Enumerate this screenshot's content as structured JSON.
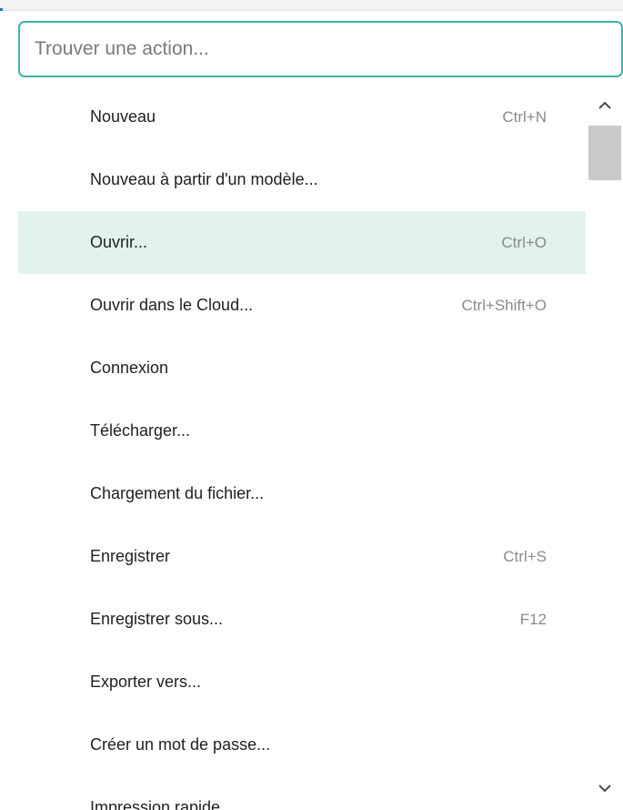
{
  "search": {
    "value": "",
    "placeholder": "Trouver une action..."
  },
  "actions": [
    {
      "label": "Nouveau",
      "shortcut": "Ctrl+N"
    },
    {
      "label": "Nouveau à partir d'un modèle...",
      "shortcut": ""
    },
    {
      "label": "Ouvrir...",
      "shortcut": "Ctrl+O",
      "highlighted": true
    },
    {
      "label": "Ouvrir dans le Cloud...",
      "shortcut": "Ctrl+Shift+O"
    },
    {
      "label": "Connexion",
      "shortcut": ""
    },
    {
      "label": "Télécharger...",
      "shortcut": ""
    },
    {
      "label": "Chargement du fichier...",
      "shortcut": ""
    },
    {
      "label": "Enregistrer",
      "shortcut": "Ctrl+S"
    },
    {
      "label": "Enregistrer sous...",
      "shortcut": "F12"
    },
    {
      "label": "Exporter vers...",
      "shortcut": ""
    },
    {
      "label": "Créer un mot de passe...",
      "shortcut": ""
    },
    {
      "label": "Impression rapide",
      "shortcut": ""
    }
  ],
  "scrollbar": {
    "up_icon": "chevron-up-icon",
    "down_icon": "chevron-down-icon",
    "scroll_position": 0.0
  },
  "colors": {
    "search_border": "#3bb4a6",
    "highlight": "#e2f2ef",
    "shortcut_text": "#8a8a8a",
    "scroll_thumb": "#c9c9c9"
  }
}
